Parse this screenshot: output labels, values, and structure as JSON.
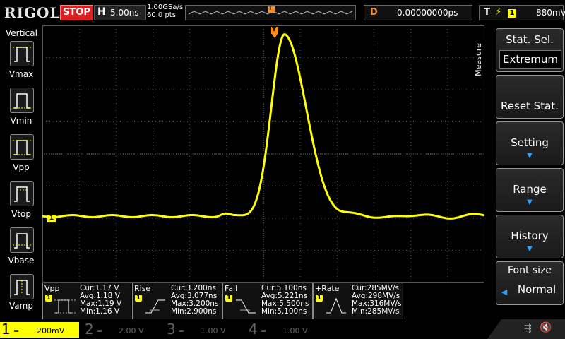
{
  "header": {
    "brand": "RIGOL",
    "run_state": "STOP",
    "timebase_label": "H",
    "timebase_value": "5.00ns",
    "sample_rate": "1.00GSa/s",
    "memory_depth": "60.0 pts",
    "trigger_marker": "T",
    "delay_label": "D",
    "delay_value": "0.00000000ps",
    "trigger_label": "T",
    "trigger_channel": "1",
    "trigger_level": "880mV"
  },
  "left_menu": {
    "title": "Vertical",
    "items": [
      {
        "label": "Vmax",
        "icon": "vmax-icon"
      },
      {
        "label": "Vmin",
        "icon": "vmin-icon"
      },
      {
        "label": "Vpp",
        "icon": "vpp-icon"
      },
      {
        "label": "Vtop",
        "icon": "vtop-icon"
      },
      {
        "label": "Vbase",
        "icon": "vbase-icon"
      },
      {
        "label": "Vamp",
        "icon": "vamp-icon"
      }
    ]
  },
  "right_menu": {
    "tab_label": "Measure",
    "items": [
      {
        "title": "Stat. Sel.",
        "value": "Extremum"
      },
      {
        "title": "Reset Stat.",
        "value": ""
      },
      {
        "title": "Setting",
        "value": ""
      },
      {
        "title": "Range",
        "value": ""
      },
      {
        "title": "History",
        "value": ""
      },
      {
        "title": "Font size",
        "value": "Normal"
      }
    ]
  },
  "screen": {
    "ch1_marker": "1",
    "trigger_marker": "T",
    "waveform_color": "#ffff00"
  },
  "measurements": [
    {
      "name": "Vpp",
      "cur": "Cur:1.17 V",
      "avg": "Avg:1.18 V",
      "max": "Max:1.19 V",
      "min": "Min:1.16 V"
    },
    {
      "name": "Rise",
      "cur": "Cur:3.200ns",
      "avg": "Avg:3.077ns",
      "max": "Max:3.200ns",
      "min": "Min:2.900ns"
    },
    {
      "name": "Fall",
      "cur": "Cur:5.100ns",
      "avg": "Avg:5.221ns",
      "max": "Max:5.500ns",
      "min": "Min:5.100ns"
    },
    {
      "name": "+Rate",
      "cur": "Cur:285MV/s",
      "avg": "Avg:298MV/s",
      "max": "Max:316MV/s",
      "min": "Min:285MV/s"
    }
  ],
  "channels": [
    {
      "num": "1",
      "scale": "200mV",
      "color": "#ffff00"
    },
    {
      "num": "2",
      "scale": "2.00 V",
      "color": "#00c8ff"
    },
    {
      "num": "3",
      "scale": "1.00 V",
      "color": "#ff40ff"
    },
    {
      "num": "4",
      "scale": "1.00 V",
      "color": "#2060ff"
    }
  ],
  "status_icons": [
    "usb-icon",
    "speaker-muted-icon"
  ]
}
